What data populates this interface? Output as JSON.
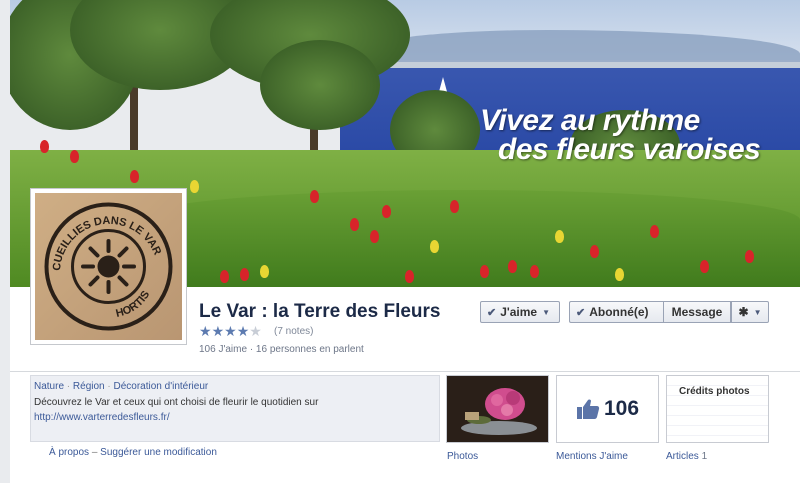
{
  "cover": {
    "line1": "Vivez au rythme",
    "line2": "des fleurs varoises"
  },
  "page": {
    "name": "Le Var : la Terre des Fleurs",
    "rating_stars": 4,
    "rating_max": 5,
    "rating_count": "(7 notes)",
    "likes_line": "106 J'aime · 16 personnes en parlent"
  },
  "buttons": {
    "like": "J'aime",
    "subscribed": "Abonné(e)",
    "message": "Message"
  },
  "about": {
    "categories": [
      "Nature",
      "Région",
      "Décoration d'intérieur"
    ],
    "description": "Découvrez le Var et ceux qui ont choisi de fleurir le quotidien sur",
    "link": "http://www.varterredesfleurs.fr/",
    "footer_about": "À propos",
    "footer_suggest": "Suggérer une modification"
  },
  "tiles": {
    "photos_label": "Photos",
    "likes_count": "106",
    "likes_label": "Mentions J'aime",
    "credits_title": "Crédits photos",
    "articles_label": "Articles",
    "articles_count": "1"
  },
  "logo": {
    "text_top": "CUEILLIES DANS LE VAR",
    "text_bottom": "HORTISUD"
  },
  "colors": {
    "link": "#3b5998",
    "title": "#1c2a47",
    "star": "#5d7bb0"
  }
}
